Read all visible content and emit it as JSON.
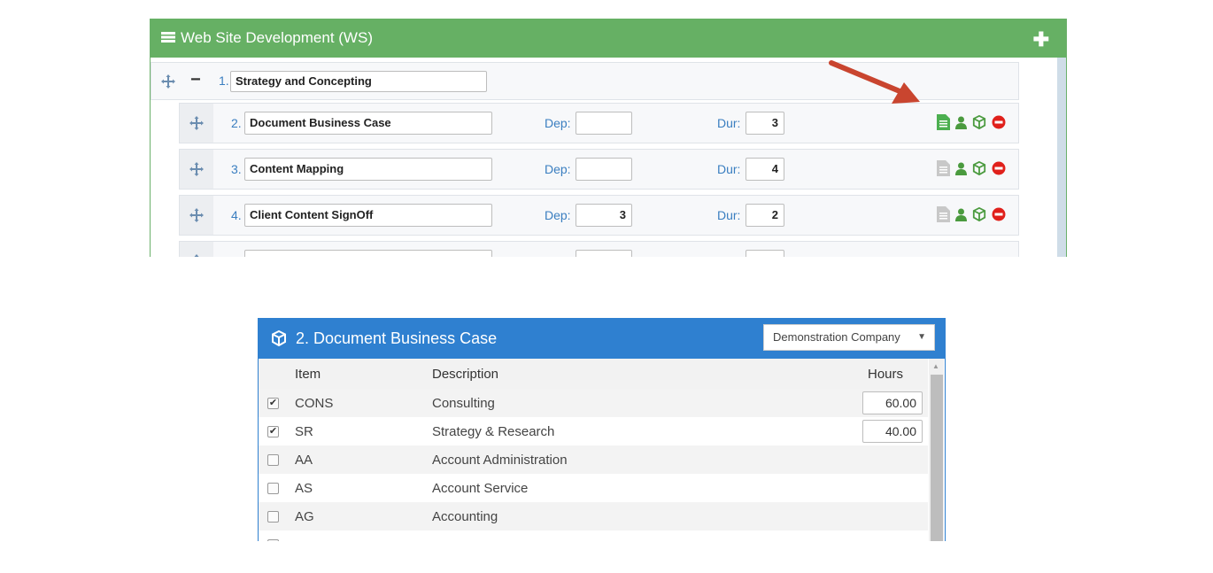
{
  "project": {
    "title": "Web Site Development (WS)",
    "colors": {
      "header": "#66b064",
      "link": "#3a7ec0"
    },
    "parent_task": {
      "number": "1.",
      "name": "Strategy and Concepting"
    },
    "dep_label": "Dep:",
    "dur_label": "Dur:",
    "tasks": [
      {
        "number": "2.",
        "name": "Document Business Case",
        "dep": "",
        "dur": "3",
        "doc_icon": "document-icon-green"
      },
      {
        "number": "3.",
        "name": "Content Mapping",
        "dep": "",
        "dur": "4",
        "doc_icon": "document-icon-gray"
      },
      {
        "number": "4.",
        "name": "Client Content SignOff",
        "dep": "3",
        "dur": "2",
        "doc_icon": "document-icon-gray"
      }
    ]
  },
  "items_panel": {
    "title": "2. Document Business Case",
    "company": "Demonstration Company",
    "color": "#2f80d0",
    "columns": {
      "item": "Item",
      "description": "Description",
      "hours": "Hours"
    },
    "rows": [
      {
        "checked": true,
        "item": "CONS",
        "description": "Consulting",
        "hours": "60.00"
      },
      {
        "checked": true,
        "item": "SR",
        "description": "Strategy & Research",
        "hours": "40.00"
      },
      {
        "checked": false,
        "item": "AA",
        "description": "Account Administration",
        "hours": ""
      },
      {
        "checked": false,
        "item": "AS",
        "description": "Account Service",
        "hours": ""
      },
      {
        "checked": false,
        "item": "AG",
        "description": "Accounting",
        "hours": ""
      }
    ]
  }
}
